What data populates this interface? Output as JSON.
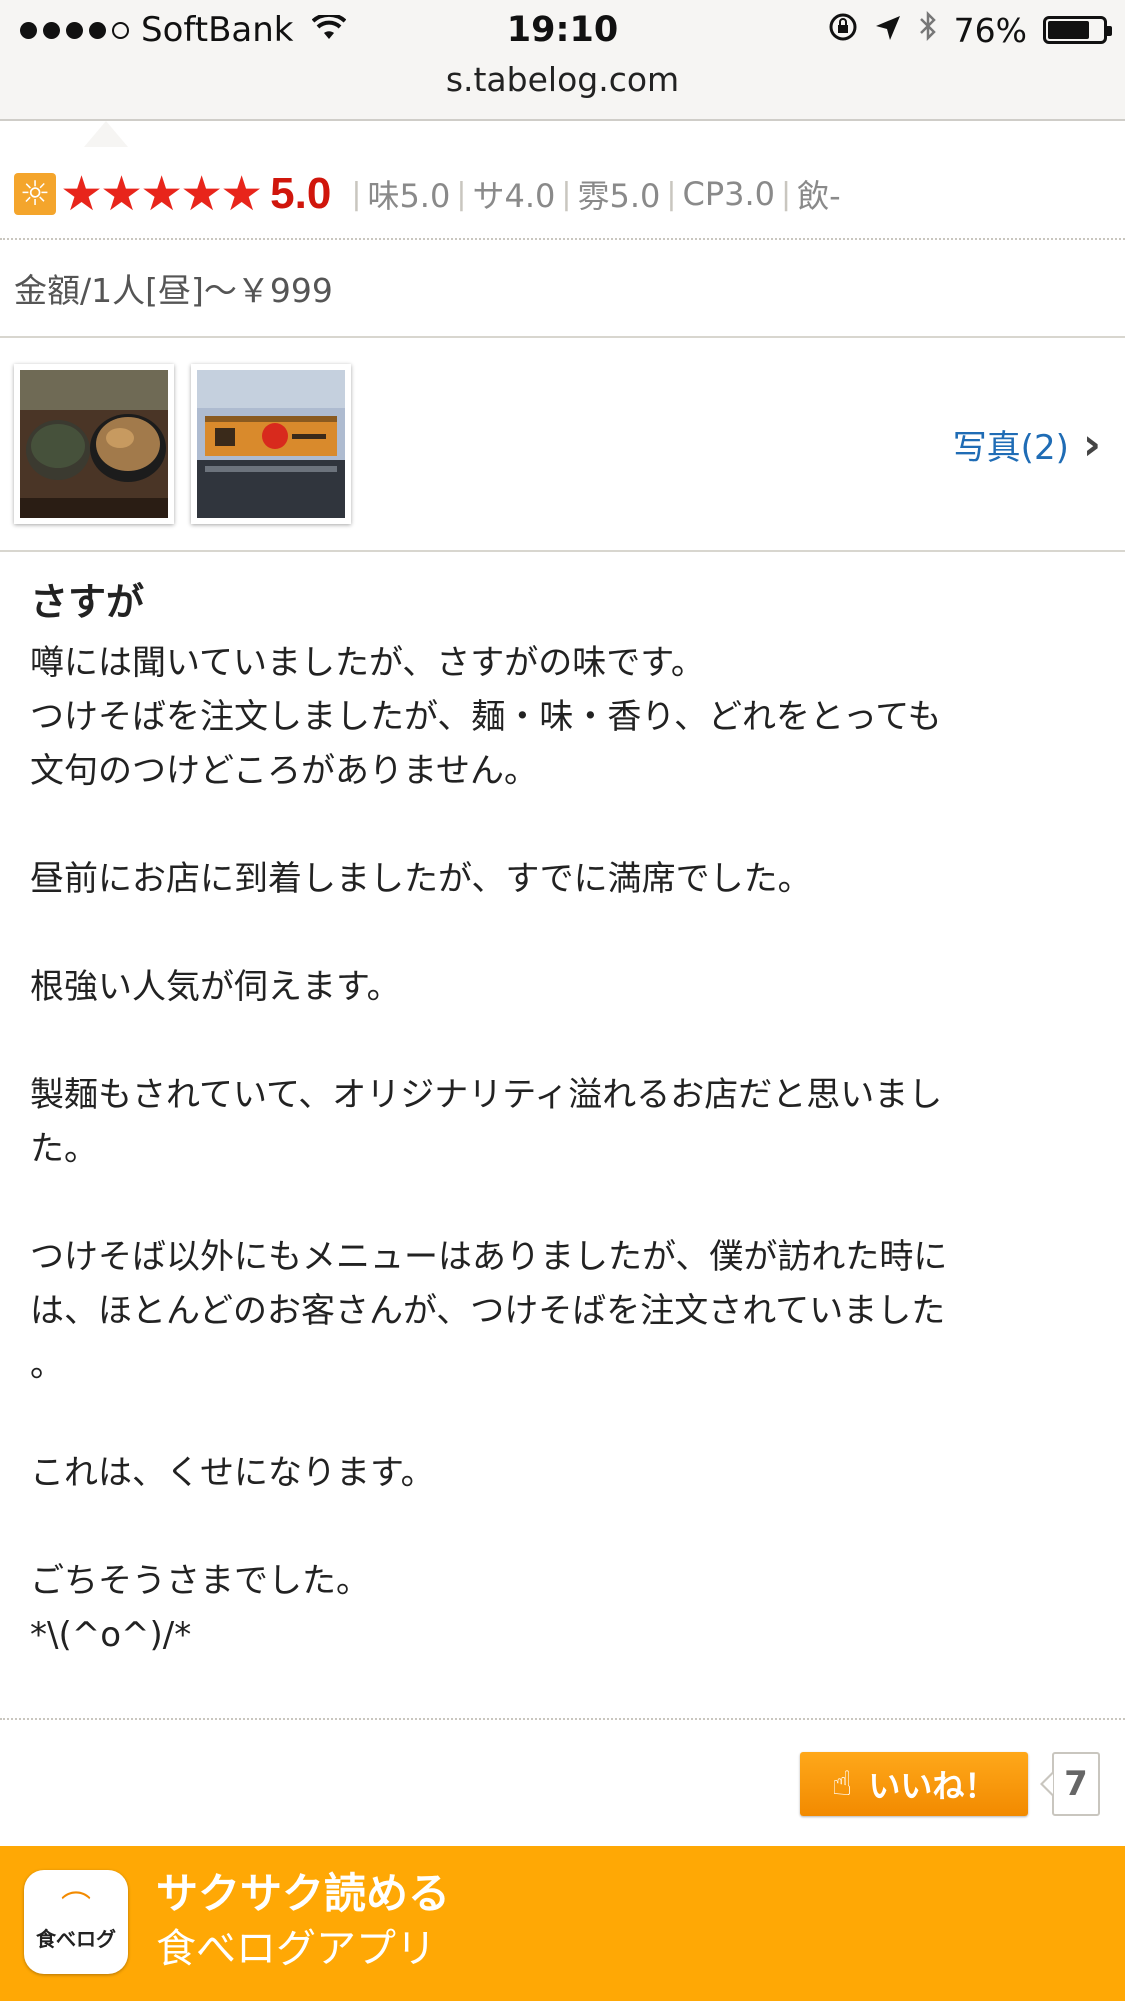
{
  "status_bar": {
    "carrier": "SoftBank",
    "time": "19:10",
    "battery_percent": "76%",
    "battery_level": 0.76
  },
  "url": "s.tabelog.com",
  "rating": {
    "score": "5.0",
    "stars": 5,
    "subscores": [
      "味5.0",
      "サ4.0",
      "雰5.0",
      "CP3.0",
      "飲-"
    ],
    "accent_color": "#d0160c",
    "star_color": "#e8251b"
  },
  "price": "金額/1人[昼]〜￥999",
  "photos": {
    "link_label": "写真(2)"
  },
  "review": {
    "title": "さすが",
    "paragraphs": [
      [
        "噂には聞いていましたが、さすがの味です。",
        "つけそばを注文しましたが、麺・味・香り、どれをとっても",
        "文句のつけどころがありません。"
      ],
      [
        "昼前にお店に到着しましたが、すでに満席でした。"
      ],
      [
        "根強い人気が伺えます。"
      ],
      [
        "製麺もされていて、オリジナリティ溢れるお店だと思いまし",
        "た。"
      ],
      [
        "つけそば以外にもメニューはありましたが、僕が訪れた時に",
        "は、ほとんどのお客さんが、つけそばを注文されていました",
        "。"
      ],
      [
        "これは、くせになります。"
      ],
      [
        "ごちそうさまでした。",
        "*\\(^o^)/*"
      ]
    ]
  },
  "like": {
    "label": "いいね！",
    "count": "7"
  },
  "app_banner": {
    "title": "サクサク読める",
    "subtitle": "食べログアプリ",
    "icon_label": "食べログ",
    "color": "#ffa805"
  }
}
